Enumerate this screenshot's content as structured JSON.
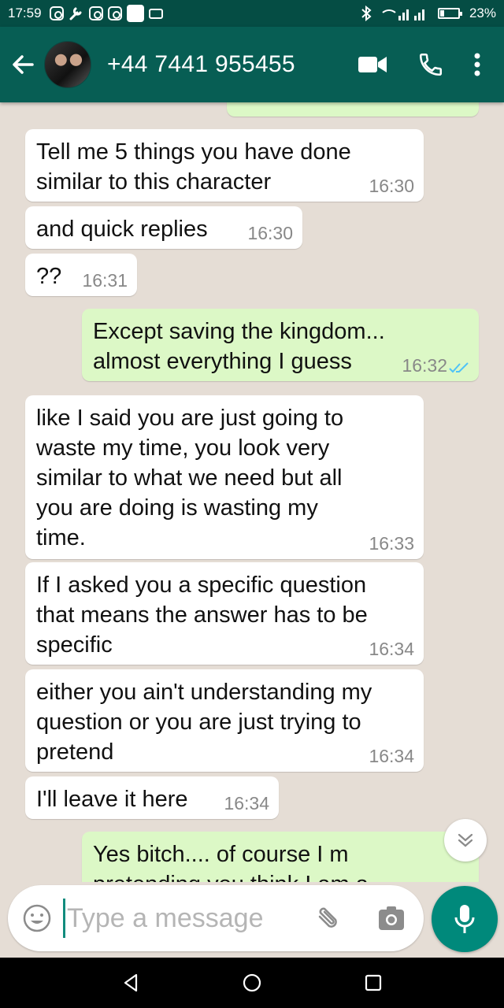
{
  "status_bar": {
    "time": "17:59",
    "battery": "23%"
  },
  "header": {
    "contact": "+44 7441 955455"
  },
  "messages": [
    {
      "dir": "in",
      "lines": [
        "Tell me 5 things you have done",
        "similar to this character"
      ],
      "time": "16:30"
    },
    {
      "dir": "in",
      "lines": [
        "and quick replies"
      ],
      "time": "16:30"
    },
    {
      "dir": "in",
      "lines": [
        "??"
      ],
      "time": "16:31"
    },
    {
      "dir": "out",
      "lines": [
        "Except saving the kingdom...",
        "almost everything I guess"
      ],
      "time": "16:32"
    },
    {
      "dir": "in",
      "lines": [
        "like I said you are just going to",
        "waste my time, you look very",
        "similar to what we need but all",
        "you are doing is wasting my",
        "time."
      ],
      "time": "16:33"
    },
    {
      "dir": "in",
      "lines": [
        "If I asked you a specific question",
        "that means the answer has to be",
        "specific"
      ],
      "time": "16:34"
    },
    {
      "dir": "in",
      "lines": [
        "either you ain't understanding my",
        "question or you are just trying to",
        "pretend"
      ],
      "time": "16:34"
    },
    {
      "dir": "in",
      "lines": [
        "I'll leave it here"
      ],
      "time": "16:34"
    },
    {
      "dir": "out",
      "lines": [
        "Yes bitch.... of course I m",
        "pretending you think I am a"
      ],
      "time": ""
    }
  ],
  "composer": {
    "placeholder": "Type a message"
  },
  "colors": {
    "header": "#075e54",
    "status": "#054d44",
    "outgoing": "#dcf8c6",
    "incoming": "#ffffff",
    "background": "#e5ddd5",
    "mic": "#00897b"
  }
}
